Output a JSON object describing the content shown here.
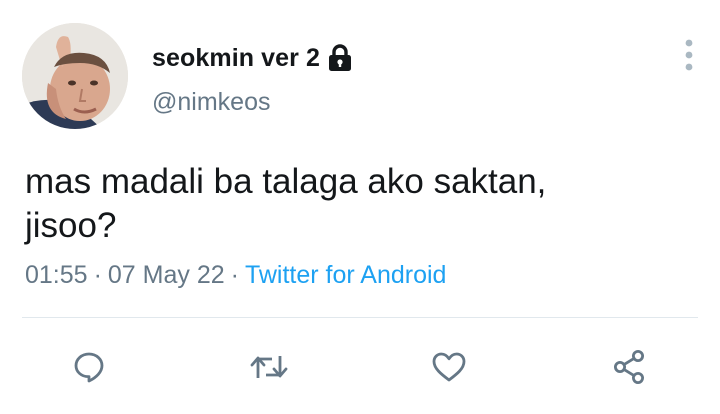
{
  "tweet": {
    "display_name": "seokmin ver 2",
    "handle": "@nimkeos",
    "text_line1": "mas madali ba talaga ako saktan,",
    "text_line2": "jisoo?",
    "time": "01:55",
    "separator": "·",
    "date": "07 May 22",
    "source": "Twitter for Android",
    "protected": true
  },
  "icons": {
    "lock": "lock-icon",
    "more": "more-vertical-icon",
    "reply": "reply-icon",
    "retweet": "retweet-icon",
    "like": "heart-icon",
    "share": "share-icon"
  },
  "colors": {
    "text": "#14171a",
    "secondary": "#657786",
    "accent": "#1da1f2",
    "divider": "#e1e8ed",
    "icon": "#657786"
  }
}
